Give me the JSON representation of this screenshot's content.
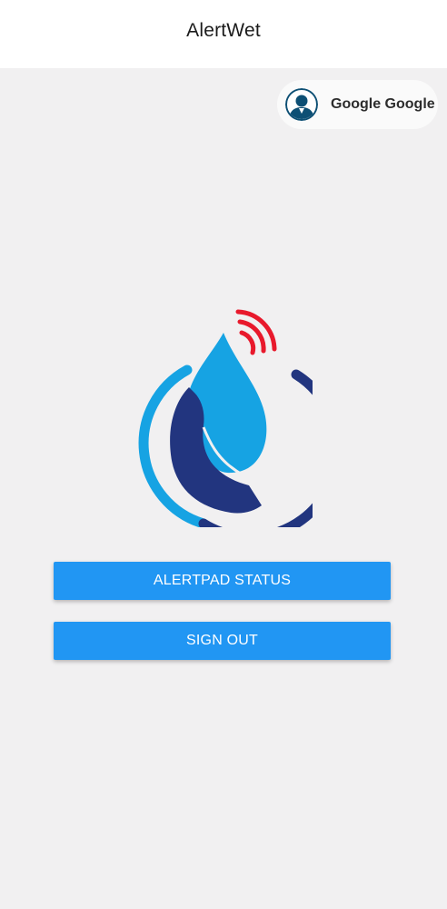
{
  "app_bar": {
    "title": "AlertWet"
  },
  "account": {
    "name": "Google Google",
    "avatar_icon": "user-avatar-icon"
  },
  "logo": {
    "icon": "water-drop-hand-alert-logo"
  },
  "buttons": {
    "status_label": "ALERTPAD STATUS",
    "signout_label": "SIGN OUT"
  },
  "colors": {
    "accent": "#2196f3",
    "logo_light_blue": "#16a3e3",
    "logo_dark_blue": "#22357f",
    "logo_signal_red": "#e8192c",
    "background": "#f1f0f1"
  }
}
